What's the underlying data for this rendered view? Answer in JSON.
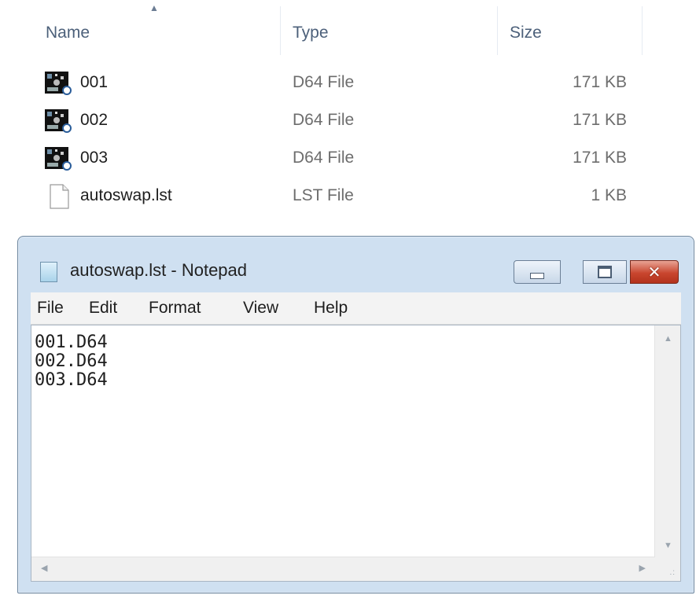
{
  "explorer": {
    "columns": {
      "name": "Name",
      "type": "Type",
      "size": "Size"
    },
    "files": [
      {
        "name": "001",
        "type": "D64 File",
        "size": "171 KB",
        "icon": "disk-image-icon"
      },
      {
        "name": "002",
        "type": "D64 File",
        "size": "171 KB",
        "icon": "disk-image-icon"
      },
      {
        "name": "003",
        "type": "D64 File",
        "size": "171 KB",
        "icon": "disk-image-icon"
      },
      {
        "name": "autoswap.lst",
        "type": "LST File",
        "size": "1 KB",
        "icon": "text-file-icon"
      }
    ]
  },
  "notepad": {
    "title": "autoswap.lst - Notepad",
    "menu": [
      "File",
      "Edit",
      "Format",
      "View",
      "Help"
    ],
    "lines": [
      "001.D64",
      "002.D64",
      "003.D64"
    ],
    "close_glyph": "✕"
  },
  "colors": {
    "title_bar": "#cfe0f1",
    "close_button": "#c9462f",
    "header_text": "#4c607a"
  }
}
